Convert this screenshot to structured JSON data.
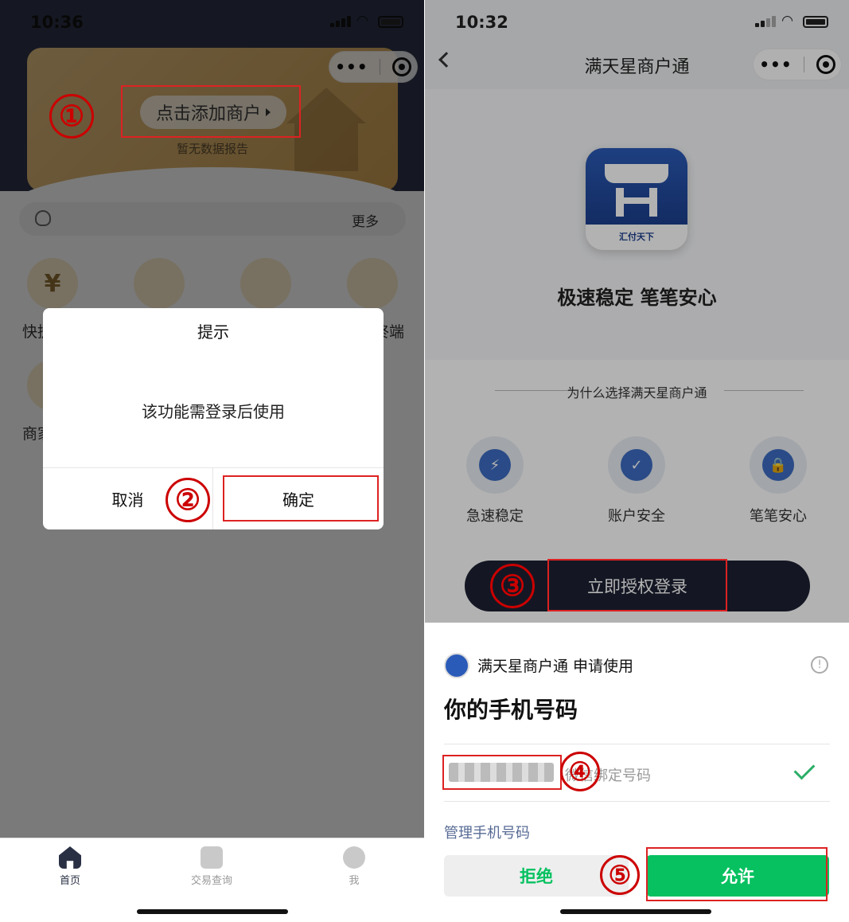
{
  "left": {
    "status": {
      "time": "10:36"
    },
    "card": {
      "add_merchant": "点击添加商户",
      "no_data": "暂无数据报告"
    },
    "notice": {
      "more": "更多"
    },
    "functions": [
      {
        "icon_text": "¥",
        "label": "快捷"
      },
      {
        "icon_text": "",
        "label": ""
      },
      {
        "icon_text": "",
        "label": ""
      },
      {
        "icon_text": "",
        "label": "终端"
      },
      {
        "icon_text": "",
        "label": "商家"
      }
    ],
    "dialog": {
      "title": "提示",
      "message": "该功能需登录后使用",
      "cancel": "取消",
      "confirm": "确定"
    },
    "tabs": [
      {
        "label": "首页",
        "icon": "home-icon"
      },
      {
        "label": "交易查询",
        "icon": "search-doc-icon"
      },
      {
        "label": "我",
        "icon": "user-icon"
      }
    ]
  },
  "right": {
    "status": {
      "time": "10:32"
    },
    "nav_title": "满天星商户通",
    "logo_brand": "汇付天下",
    "slogan": "极速稳定 笔笔安心",
    "why_title": "为什么选择满天星商户通",
    "features": [
      {
        "label": "急速稳定",
        "icon": "lightning-icon",
        "glyph": "⚡"
      },
      {
        "label": "账户安全",
        "icon": "shield-check-icon",
        "glyph": "✓"
      },
      {
        "label": "笔笔安心",
        "icon": "lock-icon",
        "glyph": "🔒"
      }
    ],
    "authorize_button": "立即授权登录",
    "sheet": {
      "app_name": "满天星商户通  申请使用",
      "title": "你的手机号码",
      "phone_note": "微信绑定号码",
      "manage": "管理手机号码",
      "reject": "拒绝",
      "allow": "允许"
    }
  },
  "steps": [
    "①",
    "②",
    "③",
    "④",
    "⑤"
  ],
  "colors": {
    "accent_red": "#cc0000",
    "wechat_green": "#07c160",
    "dark_navy": "#1e2233",
    "gold": "#d4ad6a"
  }
}
